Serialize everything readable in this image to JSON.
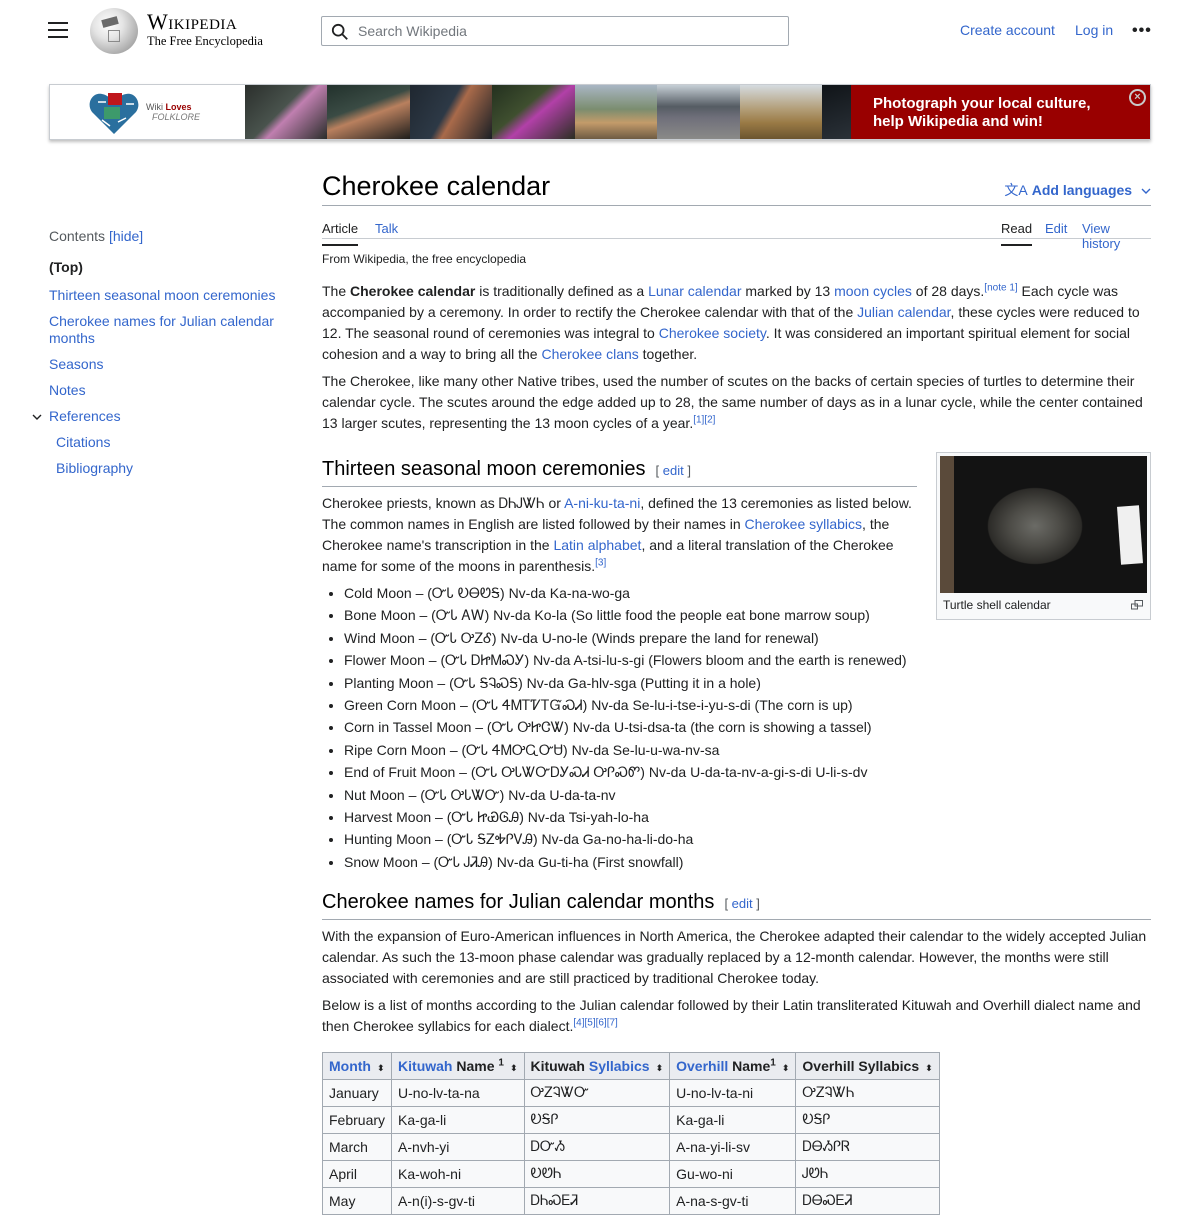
{
  "header": {
    "logo_title": "Wikipedia",
    "logo_tagline": "The Free Encyclopedia",
    "search_placeholder": "Search Wikipedia",
    "create_account": "Create account",
    "log_in": "Log in",
    "more": "•••"
  },
  "banner": {
    "logo_line1_a": "Wiki ",
    "logo_line1_b": "Loves",
    "logo_line2": "FOLKLORE",
    "cta_line1": "Photograph your local culture,",
    "cta_line2": "help Wikipedia and win!",
    "close": "×",
    "bg_color": "#990000"
  },
  "toc": {
    "title": "Contents",
    "hide": "[hide]",
    "items": [
      {
        "label": "(Top)"
      },
      {
        "label": "Thirteen seasonal moon ceremonies"
      },
      {
        "label": "Cherokee names for Julian calendar months"
      },
      {
        "label": "Seasons"
      },
      {
        "label": "Notes"
      },
      {
        "label": "References"
      },
      {
        "label": "Citations"
      },
      {
        "label": "Bibliography"
      }
    ]
  },
  "article": {
    "title": "Cherokee calendar",
    "add_languages": "Add languages",
    "tabs": {
      "article": "Article",
      "talk": "Talk",
      "read": "Read",
      "edit": "Edit",
      "history": "View history"
    },
    "tagline": "From Wikipedia, the free encyclopedia",
    "intro": {
      "t1": "The ",
      "bold": "Cherokee calendar",
      "t2": " is traditionally defined as a ",
      "l1": "Lunar calendar",
      "t3": " marked by 13 ",
      "l2": "moon cycles",
      "t4": " of 28 days.",
      "note1": "[note 1]",
      "t5": " Each cycle was accompanied by a ceremony. In order to rectify the Cherokee calendar with that of the ",
      "l3": "Julian calendar",
      "t6": ", these cycles were reduced to 12. The seasonal round of ceremonies was integral to ",
      "l4": "Cherokee society",
      "t7": ". It was considered an important spiritual element for social cohesion and a way to bring all the ",
      "l5": "Cherokee clans",
      "t8": " together."
    },
    "para2": {
      "text": "The Cherokee, like many other Native tribes, used the number of scutes on the backs of certain species of turtles to determine their calendar cycle. The scutes around the edge added up to 28, the same number of days as in a lunar cycle, while the center contained 13 larger scutes, representing the 13 moon cycles of a year.",
      "refs": "[1][2]"
    },
    "sec1": {
      "heading": "Thirteen seasonal moon ceremonies",
      "edit_open": "[ ",
      "edit": "edit",
      "edit_close": " ]",
      "p": {
        "t1": "Cherokee priests, known as ᎠᏂᎫᏔᏂ or ",
        "l1": "A-ni-ku-ta-ni",
        "t2": ", defined the 13 ceremonies as listed below. The common names in English are listed followed by their names in ",
        "l2": "Cherokee syllabics",
        "t3": ", the Cherokee name's transcription in the ",
        "l3": "Latin alphabet",
        "t4": ", and a literal translation of the Cherokee name for some of the moons in parenthesis.",
        "ref": "[3]"
      },
      "moons": [
        "Cold Moon – (ᏅᏓ ᎧᎾᏬᎦ) Nv-da Ka-na-wo-ga",
        "Bone Moon – (ᏅᏓ ᎪᎳ) Nv-da Ko-la (So little food the people eat bone marrow soup)",
        "Wind Moon – (ᏅᏓ ᎤᏃᎴ) Nv-da U-no-le (Winds prepare the land for renewal)",
        "Flower Moon – (ᏅᏓ ᎠᏥᎷᏍᎩ) Nv-da A-tsi-lu-s-gi (Flowers bloom and the earth is renewed)",
        "Planting Moon – (ᏅᏓ ᎦᎸᏍᎦ) Nv-da Ga-hlv-sga (Putting it in a hole)",
        "Green Corn Moon – (ᏅᏓ ᏎᎷᎢᏤᎢᏳᏍᏗ) Nv-da Se-lu-i-tse-i-yu-s-di (The corn is up)",
        "Corn in Tassel Moon – (ᏅᏓ ᎤᏥᏣᏔ) Nv-da U-tsi-dsa-ta (the corn is showing a tassel)",
        "Ripe Corn Moon – (ᏅᏓ ᏎᎷᎤᏩᏅᏌ) Nv-da Se-lu-u-wa-nv-sa",
        "End of Fruit Moon – (ᏅᏓ ᎤᏓᏔᏅᎠᎩᏍᏗ ᎤᎵᏍᏛ) Nv-da U-da-ta-nv-a-gi-s-di U-li-s-dv",
        "Nut Moon – (ᏅᏓ ᎤᏓᏔᏅ) Nv-da U-da-ta-nv",
        "Harvest Moon – (ᏅᏓ ᏥᏯᎶᎯ) Nv-da Tsi-yah-lo-ha",
        "Hunting Moon – (ᏅᏓ ᎦᏃᎭᎵᏙᎯ) Nv-da Ga-no-ha-li-do-ha",
        "Snow Moon – (ᏅᏓ ᎫᏘᎯ) Nv-da Gu-ti-ha (First snowfall)"
      ]
    },
    "figure": {
      "caption": "Turtle shell calendar"
    },
    "sec2": {
      "heading": "Cherokee names for Julian calendar months",
      "edit_open": "[ ",
      "edit": "edit",
      "edit_close": " ]",
      "p1": "With the expansion of Euro-American influences in North America, the Cherokee adapted their calendar to the widely accepted Julian calendar. As such the 13-moon phase calendar was gradually replaced by a 12-month calendar. However, the months were still associated with ceremonies and are still practiced by traditional Cherokee today.",
      "p2": "Below is a list of months according to the Julian calendar followed by their Latin transliterated Kituwah and Overhill dialect name and then Cherokee syllabics for each dialect.",
      "p2_refs": "[4][5][6][7]"
    },
    "table": {
      "headers": [
        {
          "link": "Month",
          "rest": "",
          "sup": ""
        },
        {
          "link": "Kituwah",
          "rest": " Name ",
          "sup": "1"
        },
        {
          "link": "",
          "pre": "Kituwah ",
          "link2": "Syllabics",
          "rest": "",
          "sup": ""
        },
        {
          "link": "Overhill",
          "rest": " Name",
          "sup": "1"
        },
        {
          "link": "",
          "pre": "Overhill Syllabics",
          "rest": "",
          "sup": ""
        }
      ],
      "sort_icon": "⬍",
      "rows": [
        [
          "January",
          "U-no-lv-ta-na",
          "ᎤᏃᎸᏔᏅ",
          "U-no-lv-ta-ni",
          "ᎤᏃᎸᏔᏂ"
        ],
        [
          "February",
          "Ka-ga-li",
          "ᎧᎦᎵ",
          "Ka-ga-li",
          "ᎧᎦᎵ"
        ],
        [
          "March",
          "A-nvh-yi",
          "ᎠᏅᏱ",
          "A-na-yi-li-sv",
          "ᎠᎾᏱᎵᏒ"
        ],
        [
          "April",
          "Ka-woh-ni",
          "ᎧᏬᏂ",
          "Gu-wo-ni",
          "ᎫᏬᏂ"
        ],
        [
          "May",
          "A-n(i)-s-gv-ti",
          "ᎠᏂᏍᎬᏘ",
          "A-na-s-gv-ti",
          "ᎠᎾᏍᎬᏘ"
        ]
      ]
    }
  }
}
